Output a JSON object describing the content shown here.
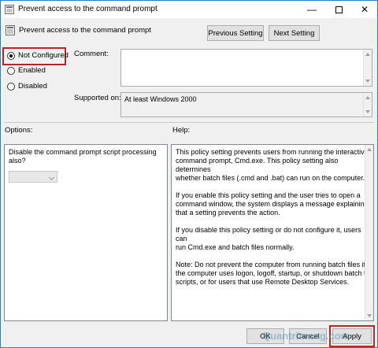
{
  "window": {
    "title": "Prevent access to the command prompt",
    "minimize_glyph": "—",
    "close_glyph": "✕"
  },
  "header": {
    "policy_name": "Prevent access to the command prompt",
    "previous_label": "Previous Setting",
    "next_label": "Next Setting"
  },
  "state": {
    "options": [
      {
        "label": "Not Configured",
        "checked": true
      },
      {
        "label": "Enabled",
        "checked": false
      },
      {
        "label": "Disabled",
        "checked": false
      }
    ]
  },
  "comment": {
    "label": "Comment:",
    "value": ""
  },
  "supported": {
    "label": "Supported on:",
    "value": "At least Windows 2000"
  },
  "options_panel": {
    "heading": "Options:",
    "question_line1": "Disable the command prompt script processing",
    "question_line2": "also?",
    "dropdown_value": ""
  },
  "help_panel": {
    "heading": "Help:",
    "paragraphs": [
      [
        "This policy setting prevents users from running the interactive",
        "command prompt, Cmd.exe.  This policy setting also determines",
        "whether batch files (.cmd and .bat) can run on the computer."
      ],
      [
        "If you enable this policy setting and the user tries to open a",
        "command window, the system displays a message explaining",
        "that a setting prevents the action."
      ],
      [
        "If you disable this policy setting or do not configure it, users can",
        "run Cmd.exe and batch files normally."
      ],
      [
        "Note: Do not prevent the computer from running batch files if",
        "the computer uses logon, logoff, startup, or shutdown batch file",
        "scripts, or for users that use Remote Desktop Services."
      ]
    ]
  },
  "footer": {
    "ok_label": "OK",
    "cancel_label": "Cancel",
    "apply_label": "Apply"
  },
  "watermark": "Quantrimang.com",
  "colors": {
    "accent_border": "#1883d7",
    "highlight": "#b2282a"
  }
}
